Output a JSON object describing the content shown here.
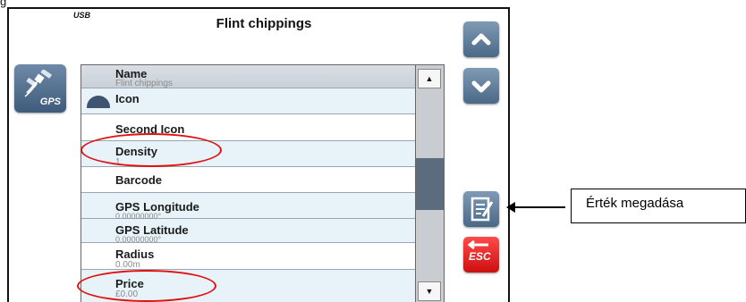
{
  "figure": {
    "label": "g"
  },
  "screen": {
    "usb": "USB",
    "title": "Flint chippings",
    "gps_button": {
      "label": "GPS",
      "icon": "satellite-icon"
    },
    "list": {
      "rows": [
        {
          "label": "Name",
          "value": "Flint chippings"
        },
        {
          "label": "Icon",
          "value": ""
        },
        {
          "label": "Second Icon",
          "value": ""
        },
        {
          "label": "Density",
          "value": "1"
        },
        {
          "label": "Barcode",
          "value": ""
        },
        {
          "label": "GPS Longitude",
          "value": "0.00000000°"
        },
        {
          "label": "GPS Latitude",
          "value": "0.00000000°"
        },
        {
          "label": "Radius",
          "value": "0.00m"
        },
        {
          "label": "Price",
          "value": "£0.00"
        }
      ],
      "scroll_up": "▲",
      "scroll_down": "▼"
    },
    "side_buttons": {
      "up_icon": "chevron-up-icon",
      "down_icon": "chevron-down-icon",
      "edit_icon": "edit-note-icon",
      "esc_label": "ESC"
    }
  },
  "annotation": {
    "callout": "Érték megadása"
  },
  "colors": {
    "accent_blue": "#4a6987",
    "esc_red": "#dd1a1a",
    "highlight_oval": "#e01010",
    "row_tint": "#e7f3f8"
  }
}
